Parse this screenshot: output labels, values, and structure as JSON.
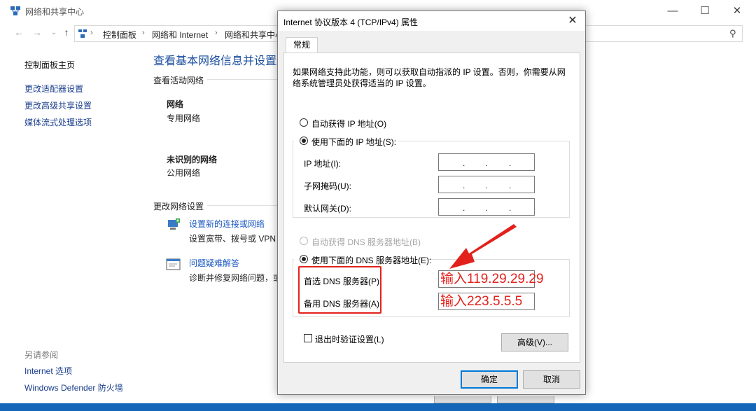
{
  "background_window": {
    "title": "网络和共享中心",
    "breadcrumb": [
      "控制面板",
      "网络和 Internet",
      "网络和共享中心"
    ],
    "sidebar": {
      "items": [
        "控制面板主页",
        "更改适配器设置",
        "更改高级共享设置",
        "媒体流式处理选项"
      ],
      "see_also_label": "另请参阅",
      "see_also": [
        "Internet 选项",
        "Windows Defender 防火墙"
      ]
    },
    "main": {
      "heading": "查看基本网络信息并设置连",
      "active_networks_label": "查看活动网络",
      "networks": [
        {
          "name": "网络",
          "type": "专用网络"
        },
        {
          "name": "未识别的网络",
          "type": "公用网络"
        }
      ],
      "change_settings_label": "更改网络设置",
      "tasks": [
        {
          "title": "设置新的连接或网络",
          "desc": "设置宽带、拨号或 VPN 连"
        },
        {
          "title": "问题疑难解答",
          "desc": "诊断并修复网络问题，或"
        }
      ]
    }
  },
  "dialog": {
    "title": "Internet 协议版本 4 (TCP/IPv4) 属性",
    "close_glyph": "✕",
    "tab": "常规",
    "description_line1": "如果网络支持此功能，则可以获取自动指派的 IP 设置。否则，你需要从网",
    "description_line2": "络系统管理员处获得适当的 IP 设置。",
    "auto_ip": "自动获得 IP 地址(O)",
    "manual_ip": "使用下面的 IP 地址(S):",
    "ip_address_label": "IP 地址(I):",
    "subnet_label": "子网掩码(U):",
    "gateway_label": "默认网关(D):",
    "auto_dns": "自动获得 DNS 服务器地址(B)",
    "manual_dns": "使用下面的 DNS 服务器地址(E):",
    "preferred_dns_label": "首选 DNS 服务器(P):",
    "alternate_dns_label": "备用 DNS 服务器(A):",
    "preferred_dns_value": "输入119.29.29.29",
    "alternate_dns_value": "输入223.5.5.5",
    "validate_label": "退出时验证设置(L)",
    "advanced_button": "高级(V)...",
    "ok_button": "确定",
    "cancel_button": "取消",
    "selected": {
      "ip_mode": "manual",
      "dns_mode": "manual",
      "validate_checked": false
    }
  },
  "colors": {
    "accent": "#0078d7",
    "annotation": "#e3211c",
    "desktop": "#1565b8"
  }
}
